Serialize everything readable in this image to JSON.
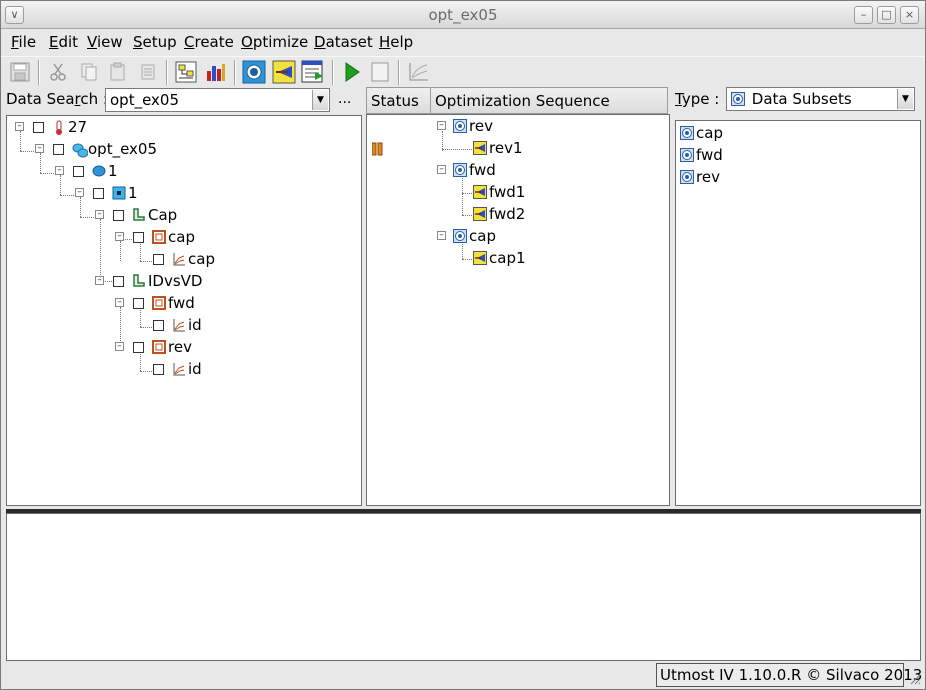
{
  "window": {
    "title": "opt_ex05"
  },
  "menu": [
    "File",
    "Edit",
    "View",
    "Setup",
    "Create",
    "Optimize",
    "Dataset",
    "Help"
  ],
  "menu_underline": [
    "F",
    "E",
    "V",
    "S",
    "C",
    "O",
    "D",
    "H"
  ],
  "toolbar": {
    "icons": [
      "save-icon",
      "cut-icon",
      "copy-icon",
      "paste-icon",
      "delete-icon",
      "routine-icon",
      "chart-bars-icon",
      "dataset-icon",
      "optimizer-icon",
      "spreadsheet-icon",
      "run-icon",
      "stop-icon",
      "plot-icon"
    ]
  },
  "left": {
    "search_label_pre": "Data Sea",
    "search_label_u": "r",
    "search_label_post": "ch :",
    "search_value": "opt_ex05",
    "ellipsis": "...",
    "tree": [
      {
        "label": "27",
        "icon": "temperature-icon"
      },
      {
        "label": "opt_ex05",
        "icon": "project-icon"
      },
      {
        "label": "1",
        "icon": "wafer-icon"
      },
      {
        "label": "1",
        "icon": "die-icon"
      },
      {
        "label": "Cap",
        "icon": "device-icon"
      },
      {
        "label": "cap",
        "icon": "routine-icon"
      },
      {
        "label": "cap",
        "icon": "plot-icon"
      },
      {
        "label": "IDvsVD",
        "icon": "device-icon"
      },
      {
        "label": "fwd",
        "icon": "routine-icon"
      },
      {
        "label": "id",
        "icon": "plot-icon"
      },
      {
        "label": "rev",
        "icon": "routine-icon"
      },
      {
        "label": "id",
        "icon": "plot-icon"
      }
    ]
  },
  "middle": {
    "col_status": "Status",
    "col_sequence": "Optimization Sequence",
    "sequence": [
      {
        "label": "rev",
        "kind": "subset"
      },
      {
        "label": "rev1",
        "kind": "opt",
        "status": "paused"
      },
      {
        "label": "fwd",
        "kind": "subset"
      },
      {
        "label": "fwd1",
        "kind": "opt"
      },
      {
        "label": "fwd2",
        "kind": "opt"
      },
      {
        "label": "cap",
        "kind": "subset"
      },
      {
        "label": "cap1",
        "kind": "opt"
      }
    ]
  },
  "right": {
    "type_label_u": "T",
    "type_label_post": "ype :",
    "type_value": "Data Subsets",
    "items": [
      "cap",
      "fwd",
      "rev"
    ]
  },
  "status": {
    "text": "Utmost IV 1.10.0.R © Silvaco 2013"
  },
  "colors": {
    "accent_yellow": "#f2e23c",
    "run_green": "#1ea01e",
    "dataset_blue": "#4a7fd1"
  }
}
